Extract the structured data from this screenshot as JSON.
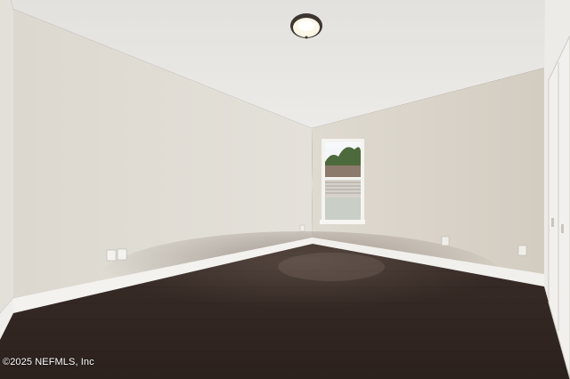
{
  "photo": {
    "watermark": "©2025 NEFMLS, Inc",
    "colors": {
      "ceiling": "#e8e6e2",
      "left_wall": "#ddd9d1",
      "right_wall": "#d8d2c8",
      "floor": "#3a2c26",
      "baseboard": "#f3f2ee",
      "closet": "#f1f0ec"
    }
  }
}
